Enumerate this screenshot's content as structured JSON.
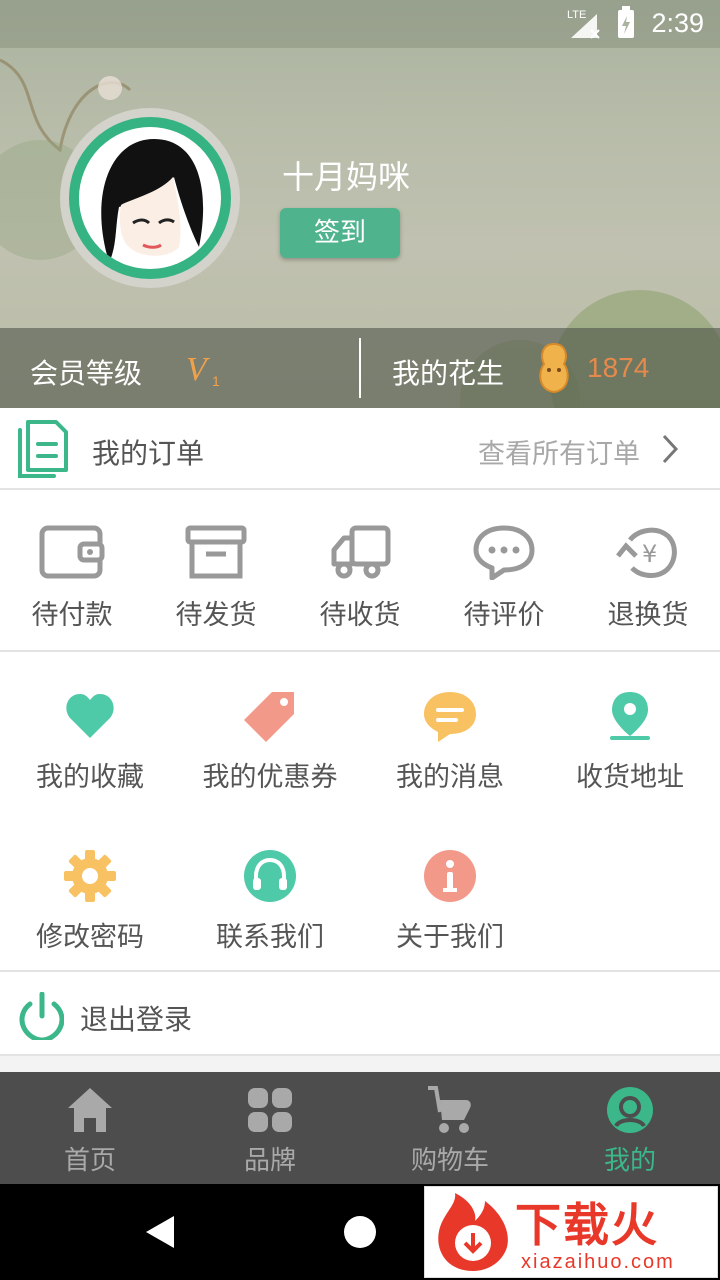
{
  "status_bar": {
    "network": "LTE",
    "time": "2:39"
  },
  "profile": {
    "username": "十月妈咪",
    "checkin_label": "签到",
    "member_level_label": "会员等级",
    "member_level_value": "V",
    "member_level_sub": "1",
    "peanut_label": "我的花生",
    "peanut_count": "1874"
  },
  "orders": {
    "title": "我的订单",
    "view_all": "查看所有订单",
    "statuses": [
      {
        "label": "待付款",
        "icon": "wallet-icon"
      },
      {
        "label": "待发货",
        "icon": "box-icon"
      },
      {
        "label": "待收货",
        "icon": "truck-icon"
      },
      {
        "label": "待评价",
        "icon": "comment-icon"
      },
      {
        "label": "退换货",
        "icon": "refund-icon"
      }
    ]
  },
  "services": [
    {
      "label": "我的收藏",
      "icon": "heart-icon",
      "color": "#4fcaa8"
    },
    {
      "label": "我的优惠券",
      "icon": "tag-icon",
      "color": "#f3998a"
    },
    {
      "label": "我的消息",
      "icon": "message-icon",
      "color": "#f8c263"
    },
    {
      "label": "收货地址",
      "icon": "location-icon",
      "color": "#4fcaa8"
    },
    {
      "label": "修改密码",
      "icon": "gear-icon",
      "color": "#f8c263"
    },
    {
      "label": "联系我们",
      "icon": "headset-icon",
      "color": "#4fcaa8"
    },
    {
      "label": "关于我们",
      "icon": "info-icon",
      "color": "#f3998a"
    }
  ],
  "logout": {
    "label": "退出登录",
    "icon": "power-icon"
  },
  "tabs": [
    {
      "label": "首页",
      "icon": "home-icon",
      "active": false
    },
    {
      "label": "品牌",
      "icon": "grid-icon",
      "active": false
    },
    {
      "label": "购物车",
      "icon": "stroller-icon",
      "active": false
    },
    {
      "label": "我的",
      "icon": "profile-icon",
      "active": true
    }
  ],
  "watermark": {
    "brand": "下载火",
    "url": "xiazaihuo.com"
  },
  "colors": {
    "accent": "#3bb78a",
    "peanut": "#e58a4c",
    "tabbar": "#4d4d4d"
  }
}
